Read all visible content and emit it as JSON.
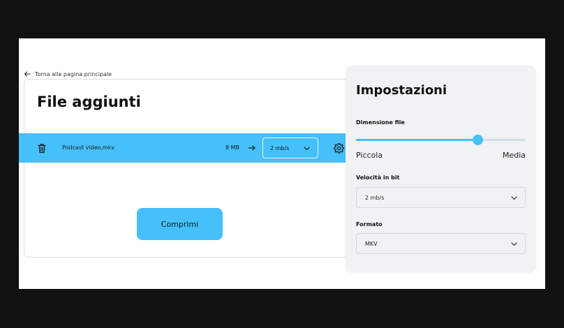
{
  "back_link": {
    "label": "Torna alla pagina principale"
  },
  "files": {
    "title": "File aggiunti",
    "rows": [
      {
        "name": "Podcast video.mkv",
        "size": "8 MB",
        "bitrate": "2 mb/s"
      }
    ],
    "compress_label": "Comprimi"
  },
  "settings": {
    "title": "Impostazioni",
    "file_size": {
      "label": "Dimensione file",
      "min_label": "Piccola",
      "max_label": "Media",
      "value_fraction": 0.72
    },
    "bitrate": {
      "label": "Velocità in bit",
      "value": "2 mb/s"
    },
    "format": {
      "label": "Formato",
      "value": "MKV"
    }
  },
  "colors": {
    "accent": "#45c0fb",
    "panel": "#f0f2f3"
  },
  "icons": [
    "back-arrow-icon",
    "trash-icon",
    "arrow-right-icon",
    "chevron-down-icon",
    "gear-icon"
  ]
}
